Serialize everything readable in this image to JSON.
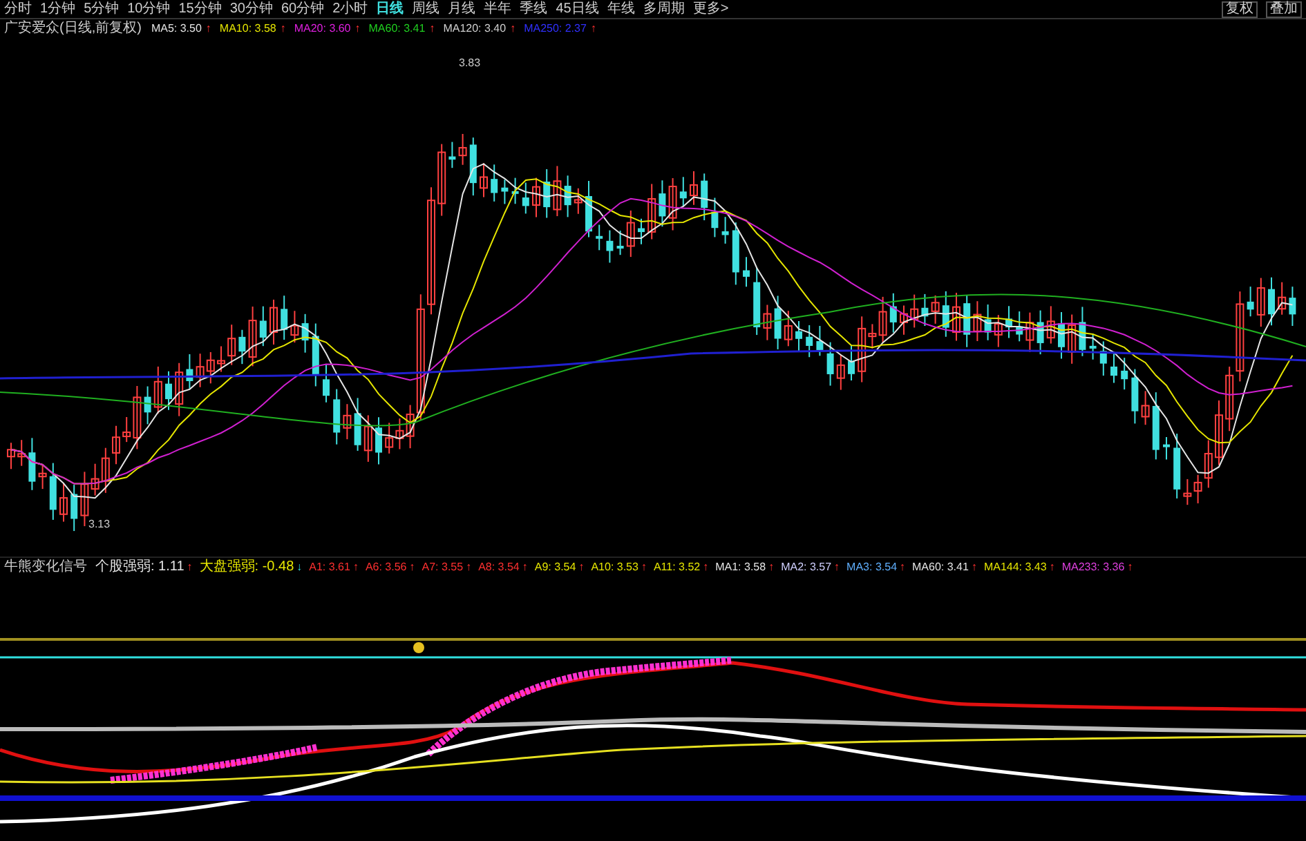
{
  "period_bar": {
    "tabs": [
      {
        "label": "分时",
        "selected": false
      },
      {
        "label": "1分钟",
        "selected": false
      },
      {
        "label": "5分钟",
        "selected": false
      },
      {
        "label": "10分钟",
        "selected": false
      },
      {
        "label": "15分钟",
        "selected": false
      },
      {
        "label": "30分钟",
        "selected": false
      },
      {
        "label": "60分钟",
        "selected": false
      },
      {
        "label": "2小时",
        "selected": false
      },
      {
        "label": "日线",
        "selected": true
      },
      {
        "label": "周线",
        "selected": false
      },
      {
        "label": "月线",
        "selected": false
      },
      {
        "label": "半年",
        "selected": false
      },
      {
        "label": "季线",
        "selected": false
      },
      {
        "label": "45日线",
        "selected": false
      },
      {
        "label": "年线",
        "selected": false
      },
      {
        "label": "多周期",
        "selected": false
      },
      {
        "label": "更多>",
        "selected": false
      }
    ],
    "right_buttons": [
      "复权",
      "叠加"
    ]
  },
  "main_chart": {
    "title": "广安爱众(日线,前复权)",
    "indicators": [
      {
        "label": "MA5: 3.50",
        "arrow": "↑",
        "color": "#e5e5e5"
      },
      {
        "label": "MA10: 3.58",
        "arrow": "↑",
        "color": "#e6e600"
      },
      {
        "label": "MA20: 3.60",
        "arrow": "↑",
        "color": "#e020e0"
      },
      {
        "label": "MA60: 3.41",
        "arrow": "↑",
        "color": "#20d020"
      },
      {
        "label": "MA120: 3.40",
        "arrow": "↑",
        "color": "#d0d0d0"
      },
      {
        "label": "MA250: 2.37",
        "arrow": "↑",
        "color": "#3030ff"
      }
    ],
    "high_label": "3.83",
    "low_label": "3.13"
  },
  "sub_chart": {
    "title": "牛熊变化信号",
    "indicators": [
      {
        "label": "个股强弱: 1.11",
        "color": "#e5e5e5",
        "arrow": "↑"
      },
      {
        "label": "大盘强弱: -0.48",
        "color": "#e6e600",
        "arrow": "↓"
      },
      {
        "label": "A1: 3.61",
        "color": "#ff3030",
        "arrow": "↑"
      },
      {
        "label": "A6: 3.56",
        "color": "#ff3030",
        "arrow": "↑"
      },
      {
        "label": "A7: 3.55",
        "color": "#ff3030",
        "arrow": "↑"
      },
      {
        "label": "A8: 3.54",
        "color": "#ff3030",
        "arrow": "↑"
      },
      {
        "label": "A9: 3.54",
        "color": "#e6e600",
        "arrow": "↑"
      },
      {
        "label": "A10: 3.53",
        "color": "#e6e600",
        "arrow": "↑"
      },
      {
        "label": "A11: 3.52",
        "color": "#e6e600",
        "arrow": "↑"
      },
      {
        "label": "MA1: 3.58",
        "color": "#e5e5e5",
        "arrow": "↑"
      },
      {
        "label": "MA2: 3.57",
        "color": "#d0d0ff",
        "arrow": "↑"
      },
      {
        "label": "MA3: 3.54",
        "color": "#60b0ff",
        "arrow": "↑"
      },
      {
        "label": "MA60: 3.41",
        "color": "#e5e5e5",
        "arrow": "↑"
      },
      {
        "label": "MA144: 3.43",
        "color": "#e6e600",
        "arrow": "↑"
      },
      {
        "label": "MA233: 3.36",
        "color": "#e040e0",
        "arrow": "↑"
      }
    ]
  }
}
